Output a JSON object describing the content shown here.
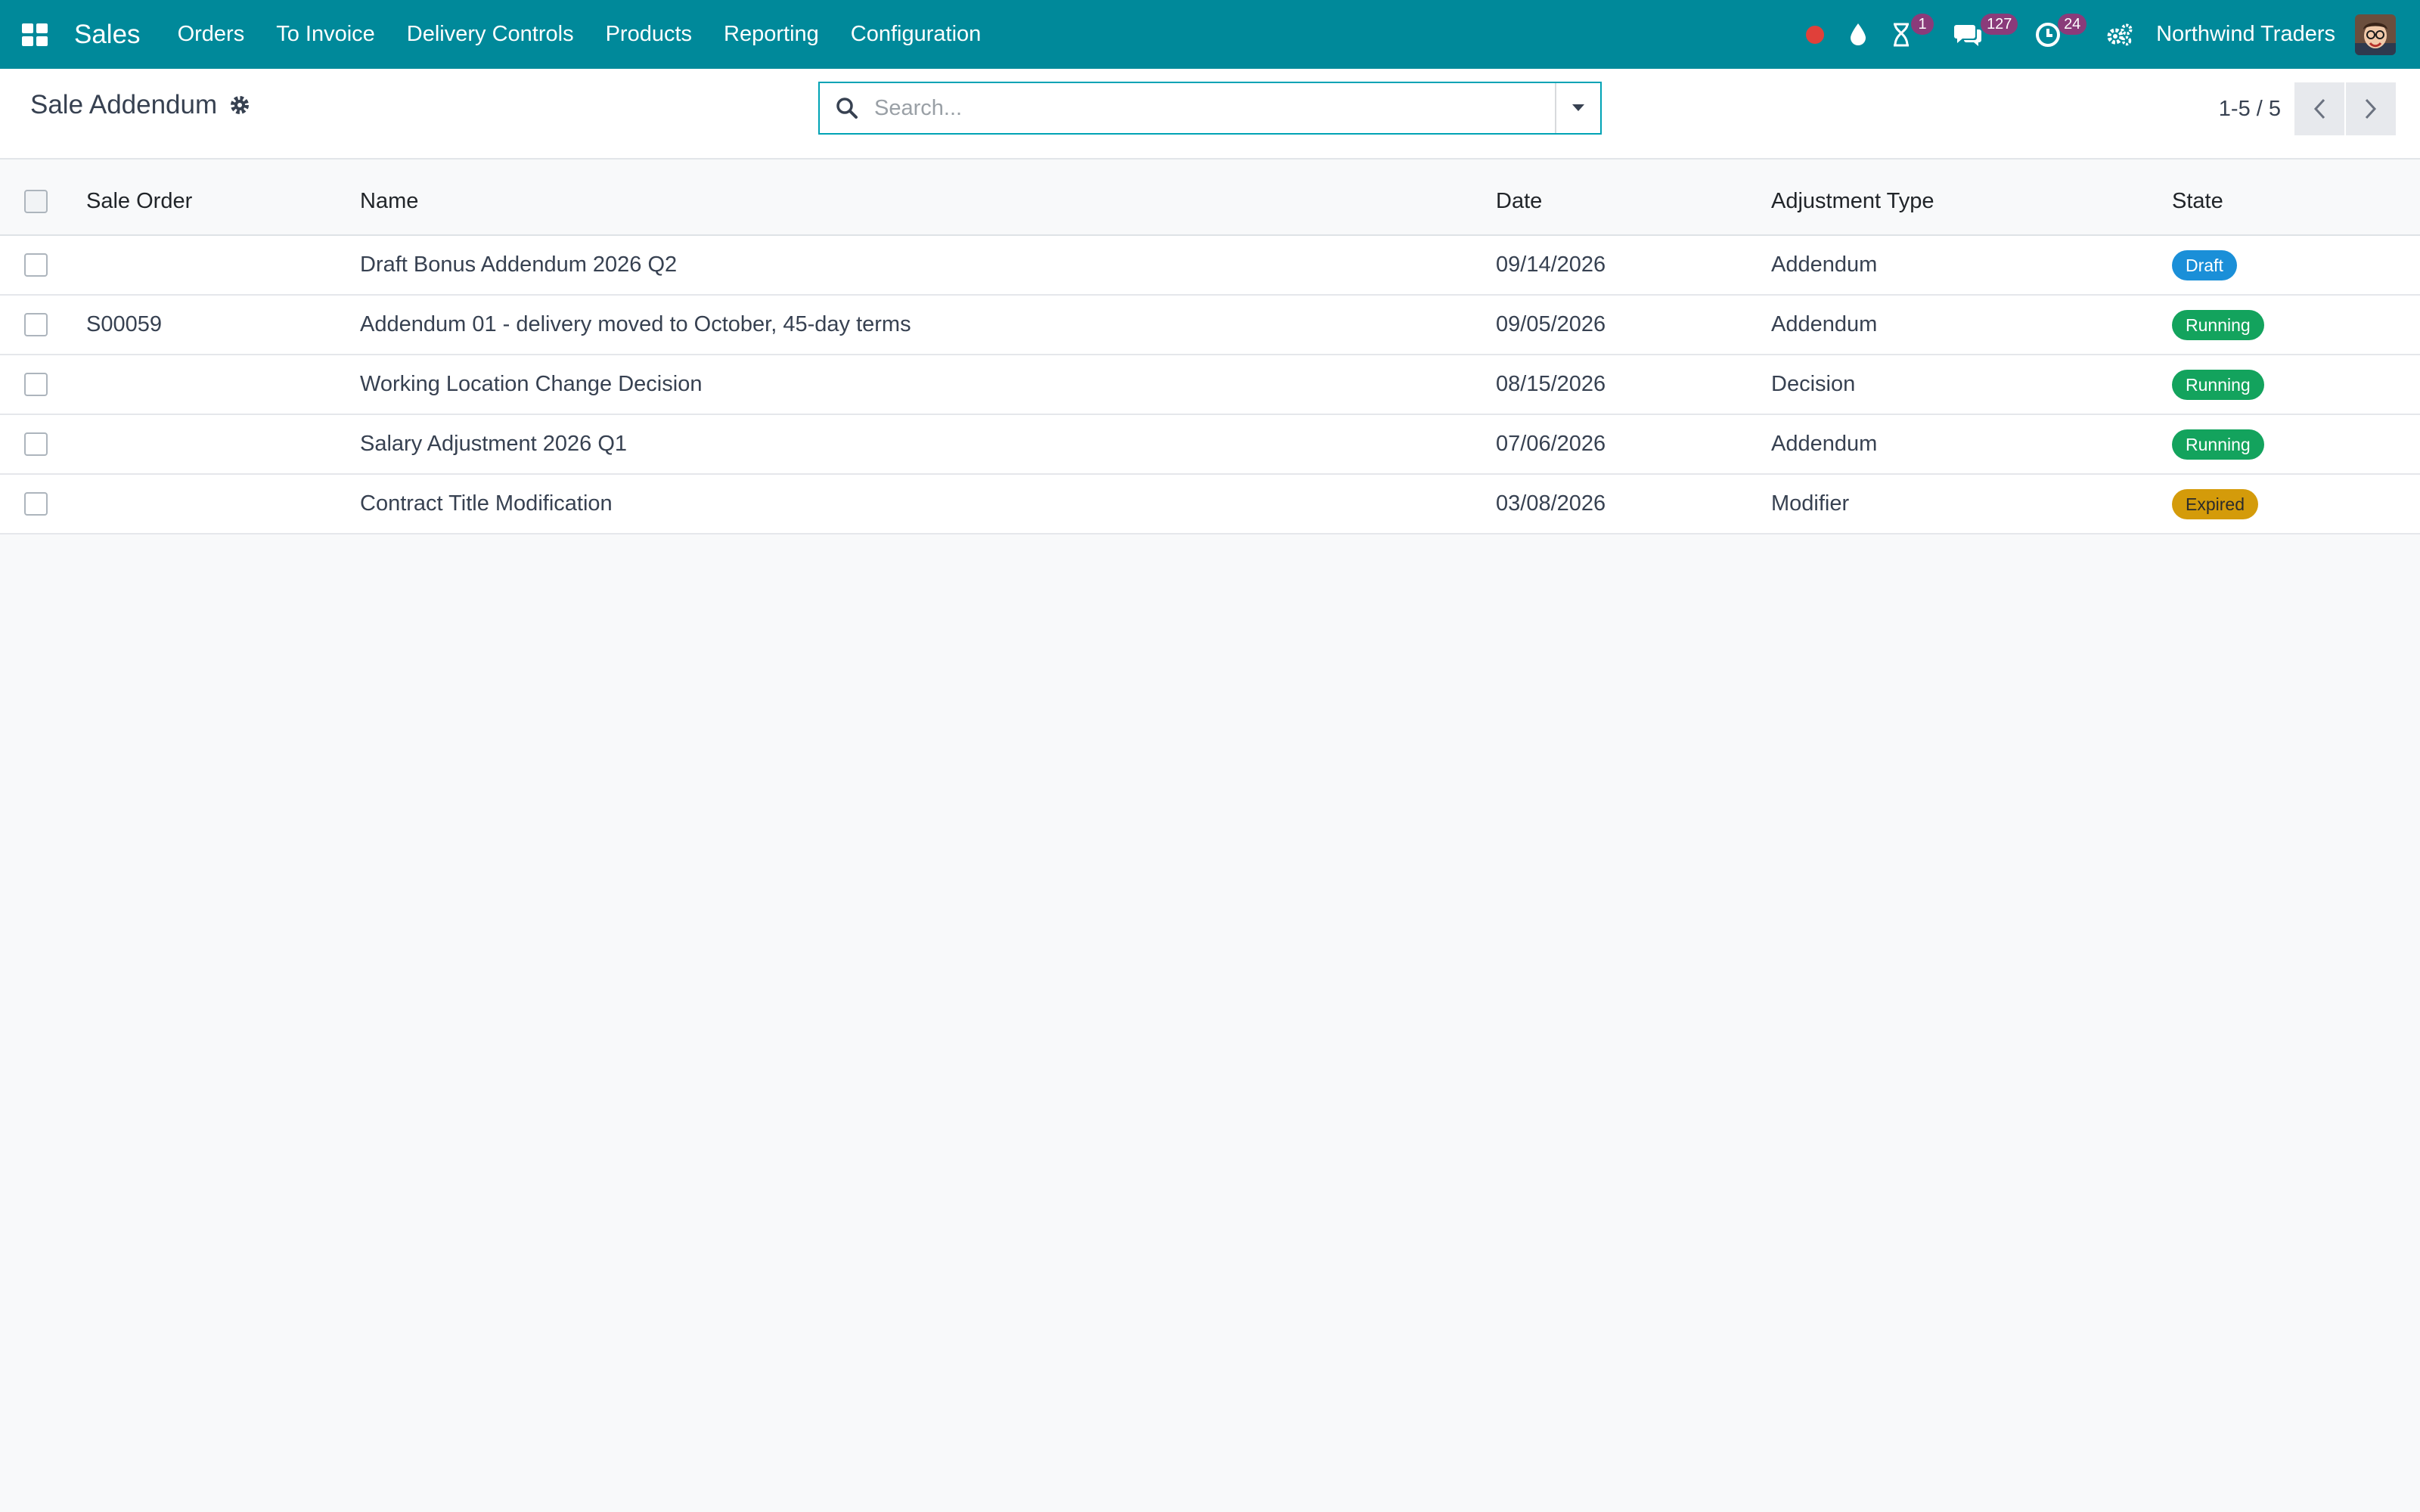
{
  "navbar": {
    "app_name": "Sales",
    "menu": [
      "Orders",
      "To Invoice",
      "Delivery Controls",
      "Products",
      "Reporting",
      "Configuration"
    ],
    "activity_count": "1",
    "messages_count": "127",
    "timer_count": "24",
    "company": "Northwind Traders"
  },
  "control_panel": {
    "title": "Sale Addendum",
    "search_placeholder": "Search...",
    "pager": "1-5 / 5"
  },
  "table": {
    "headers": [
      "Sale Order",
      "Name",
      "Date",
      "Adjustment Type",
      "State"
    ],
    "rows": [
      {
        "order": "",
        "name": "Draft Bonus Addendum 2026 Q2",
        "date": "09/14/2026",
        "type": "Addendum",
        "state": "Draft"
      },
      {
        "order": "S00059",
        "name": "Addendum 01 - delivery moved to October, 45-day terms",
        "date": "09/05/2026",
        "type": "Addendum",
        "state": "Running"
      },
      {
        "order": "",
        "name": "Working Location Change Decision",
        "date": "08/15/2026",
        "type": "Decision",
        "state": "Running"
      },
      {
        "order": "",
        "name": "Salary Adjustment 2026 Q1",
        "date": "07/06/2026",
        "type": "Addendum",
        "state": "Running"
      },
      {
        "order": "",
        "name": "Contract Title Modification",
        "date": "03/08/2026",
        "type": "Modifier",
        "state": "Expired"
      }
    ]
  },
  "colors": {
    "navbar": "#00899a",
    "draft": "#1a8fd8",
    "running": "#13a35d",
    "expired": "#d49b0a",
    "counter": "#8a3b7a",
    "recording_dot": "#e0403a"
  },
  "icons": [
    "apps-grid-icon",
    "record-dot-icon",
    "drop-icon",
    "hourglass-icon",
    "chat-icon",
    "clock-icon",
    "gears-icon",
    "gear-icon",
    "search-icon",
    "caret-down-icon",
    "chevron-left-icon",
    "chevron-right-icon"
  ]
}
